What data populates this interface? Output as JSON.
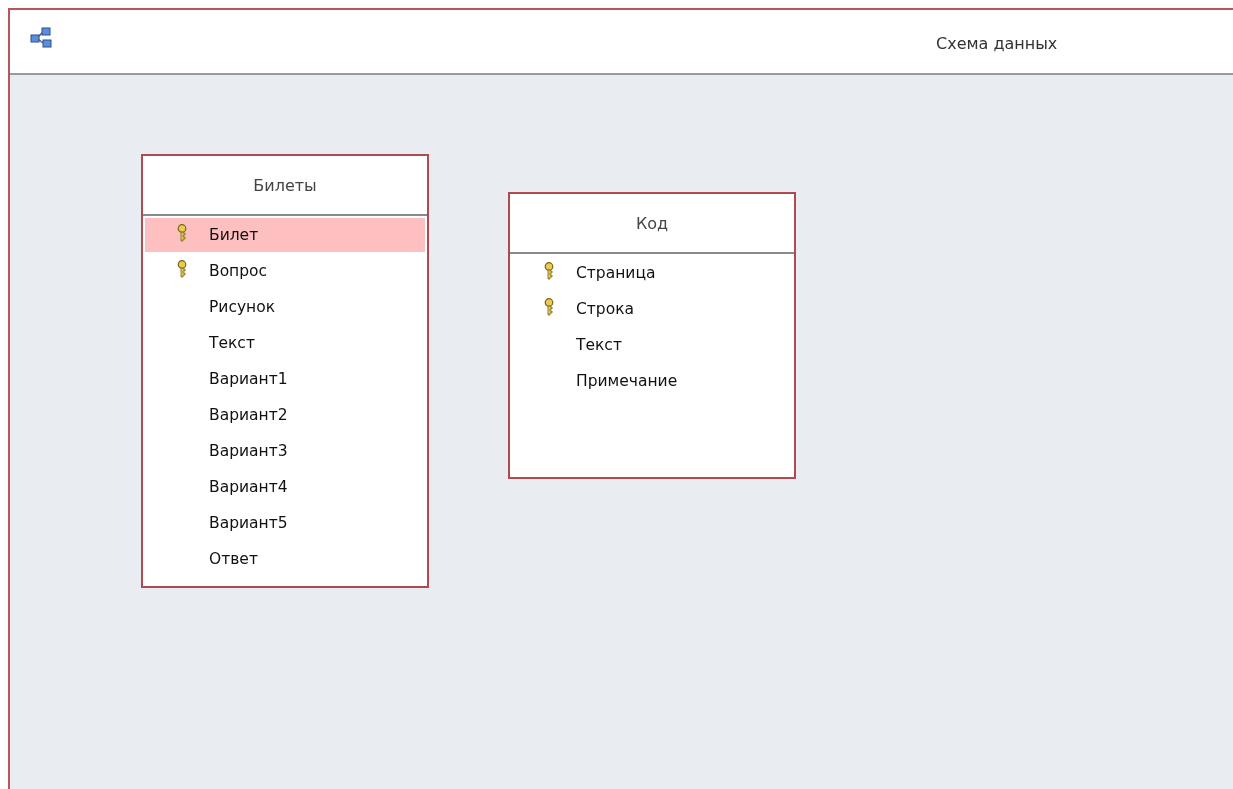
{
  "window": {
    "title": "Схема данных"
  },
  "tables": [
    {
      "name": "Билеты",
      "fields": [
        {
          "name": "Билет",
          "key": true,
          "selected": true
        },
        {
          "name": "Вопрос",
          "key": true,
          "selected": false
        },
        {
          "name": "Рисунок",
          "key": false,
          "selected": false
        },
        {
          "name": "Текст",
          "key": false,
          "selected": false
        },
        {
          "name": "Вариант1",
          "key": false,
          "selected": false
        },
        {
          "name": "Вариант2",
          "key": false,
          "selected": false
        },
        {
          "name": "Вариант3",
          "key": false,
          "selected": false
        },
        {
          "name": "Вариант4",
          "key": false,
          "selected": false
        },
        {
          "name": "Вариант5",
          "key": false,
          "selected": false
        },
        {
          "name": "Ответ",
          "key": false,
          "selected": false
        }
      ]
    },
    {
      "name": "Код",
      "fields": [
        {
          "name": "Страница",
          "key": true,
          "selected": false
        },
        {
          "name": "Строка",
          "key": true,
          "selected": false
        },
        {
          "name": "Текст",
          "key": false,
          "selected": false
        },
        {
          "name": "Примечание",
          "key": false,
          "selected": false
        }
      ]
    }
  ]
}
